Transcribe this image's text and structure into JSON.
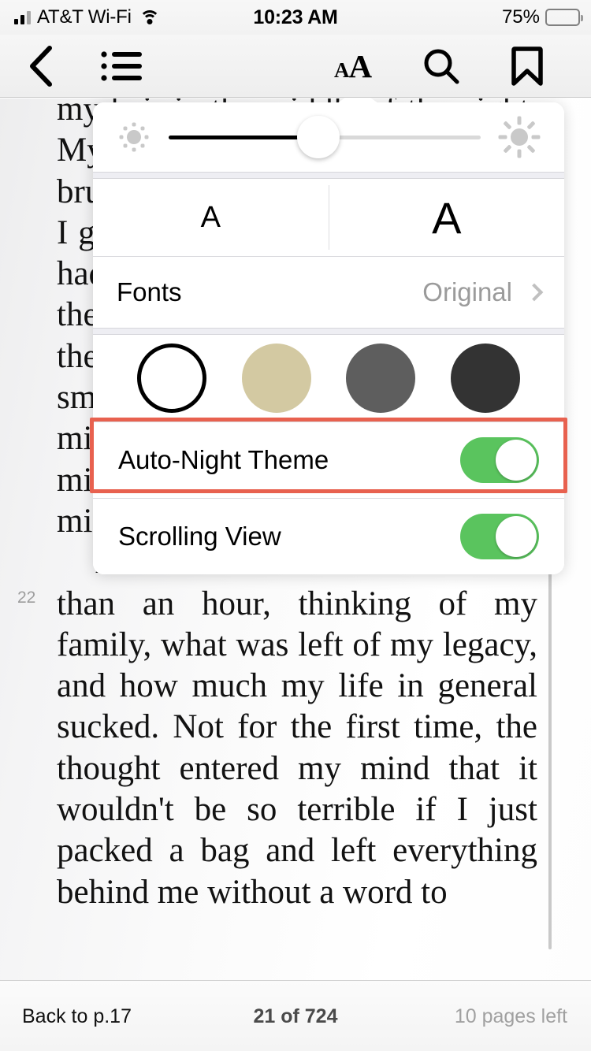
{
  "status_bar": {
    "carrier": "AT&T Wi-Fi",
    "signal_icon": "signal-bars-icon",
    "wifi_icon": "wifi-icon",
    "time": "10:23 AM",
    "battery_percent": "75%",
    "battery_icon": "battery-icon",
    "battery_level": 75
  },
  "toolbar": {
    "back_icon": "chevron-left-icon",
    "contents_icon": "list-bullet-icon",
    "font_size_icon": "aa-text-size-icon",
    "font_size_small_glyph": "A",
    "font_size_large_glyph": "A",
    "search_icon": "search-icon",
    "bookmark_icon": "bookmark-icon"
  },
  "settings_popover": {
    "brightness": {
      "low_icon": "sun-small-icon",
      "high_icon": "sun-large-icon",
      "value": 48
    },
    "font_size": {
      "decrease_label": "A",
      "increase_label": "A"
    },
    "fonts": {
      "label": "Fonts",
      "value": "Original",
      "chevron_icon": "chevron-right-icon"
    },
    "themes": [
      {
        "name": "white",
        "color": "#ffffff",
        "selected": true
      },
      {
        "name": "sepia",
        "color": "#d3c9a2",
        "selected": false
      },
      {
        "name": "gray",
        "color": "#5e5e5e",
        "selected": false
      },
      {
        "name": "dark",
        "color": "#333333",
        "selected": false
      }
    ],
    "toggles": [
      {
        "name": "auto-night-theme",
        "label": "Auto-Night Theme",
        "on": true,
        "highlighted": true
      },
      {
        "name": "scrolling-view",
        "label": "Scrolling View",
        "on": true,
        "highlighted": false
      }
    ],
    "highlight_color": "#e8614f",
    "switch_on_color": "#5ac45e"
  },
  "book_page": {
    "page_number": "22",
    "paragraphs": [
      {
        "indent": false,
        "text": "my hair in the middle of the night. My hands were shaking as I brushed my teeth, unsteady even as I gripped the edge of the counter. I had been thinking about the way the bones creak and shift beneath the skin, nudging one another like small animals, and whether my jaw might crack, whether my skull might split, whether my teeth might snap off."
      },
      {
        "indent": true,
        "text": "I'd been wide-awake for more than an hour, thinking of my family, what was left of my legacy, and how much my life in general sucked. Not for the first time, the thought entered my mind that it wouldn't be so terrible if I just packed a bag and left everything behind me without a word to"
      }
    ]
  },
  "bottom_bar": {
    "back_link": "Back to p.17",
    "progress": "21 of 724",
    "pages_left": "10 pages left"
  }
}
